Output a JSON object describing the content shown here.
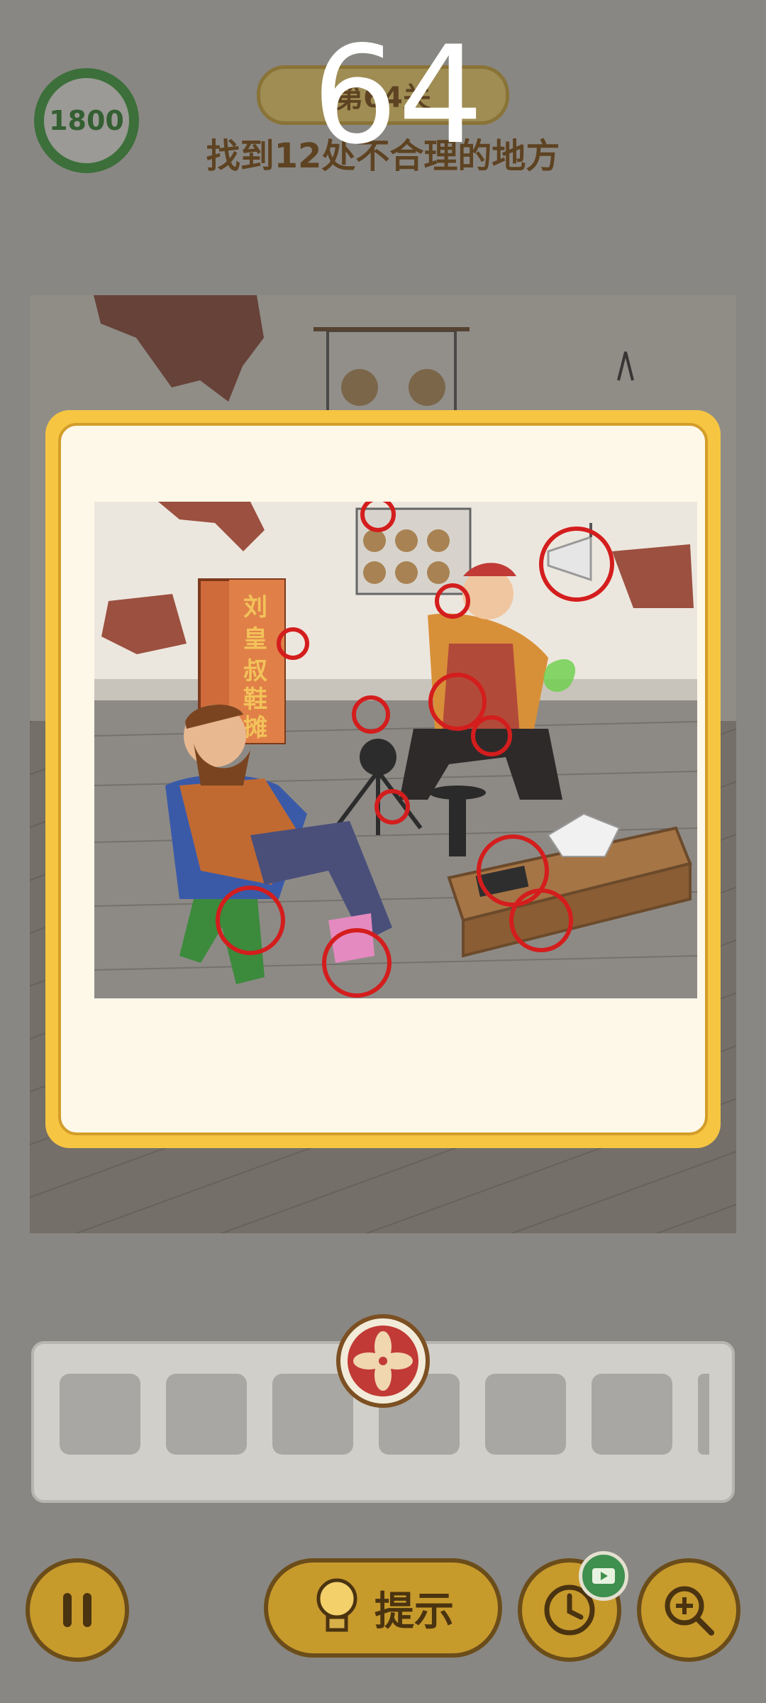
{
  "hud": {
    "score": "1800",
    "level_banner": "第64关",
    "level_number": "64",
    "task": "找到12处不合理的地方"
  },
  "scene": {
    "sign_text": [
      "刘",
      "皇",
      "叔",
      "鞋",
      "摊"
    ]
  },
  "controls": {
    "hint_label": "提示",
    "pause_icon": "pause-icon",
    "clock_icon": "clock-icon",
    "zoom_icon": "zoom-in-icon",
    "video_icon": "video-ad-icon",
    "close_icon": "close-icon"
  },
  "colors": {
    "modal_border": "#f6c542",
    "button_gold": "#c79a2c",
    "close_red": "#c13a35",
    "score_green": "#3c9b3c",
    "circle_red": "#d41d1d"
  }
}
